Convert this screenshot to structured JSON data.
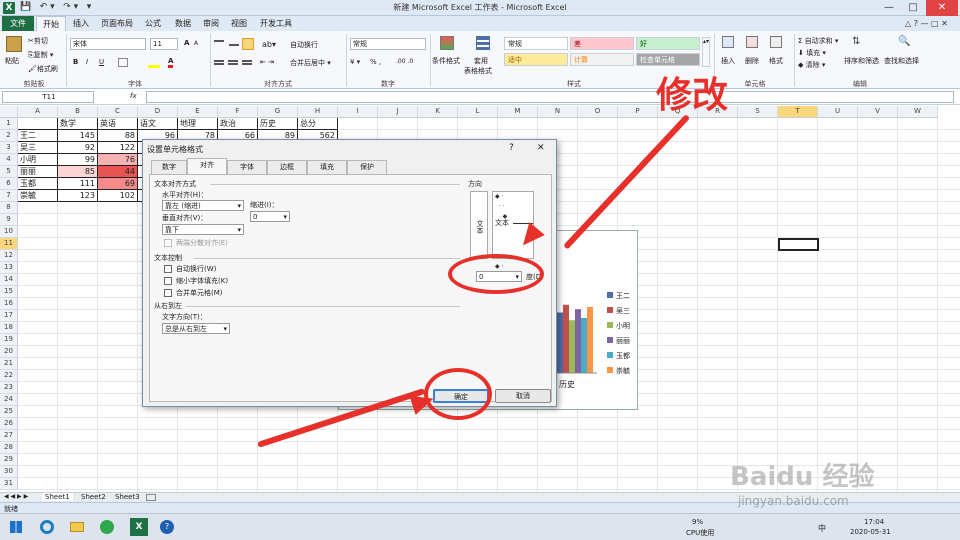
{
  "window": {
    "title": "新建 Microsoft Excel 工作表 - Microsoft Excel",
    "app_icon": "X",
    "qat": [
      "💾",
      "↶ ▾",
      "↷ ▾",
      "▾"
    ],
    "controls": [
      "—",
      "□",
      "✕"
    ],
    "ribbon_controls": [
      "△",
      "?",
      "—",
      "□",
      "✕"
    ]
  },
  "tabs": [
    "文件",
    "开始",
    "插入",
    "页面布局",
    "公式",
    "数据",
    "审阅",
    "视图",
    "开发工具"
  ],
  "ribbon": {
    "clipboard": {
      "paste": "粘贴",
      "cut": "剪切",
      "copy": "复制 ▾",
      "format_painter": "格式刷",
      "label": "剪贴板"
    },
    "font": {
      "name": "宋体",
      "size": "11",
      "bold": "B",
      "italic": "I",
      "underline": "U",
      "grow": "A",
      "shrink": "A",
      "label": "字体"
    },
    "alignment": {
      "wrap": "自动换行",
      "merge": "合并后居中 ▾",
      "label": "对齐方式"
    },
    "number": {
      "format": "常规",
      "percent": "% ,",
      "decimals": ".00 .0",
      "currency": "¥ ▾",
      "label": "数字"
    },
    "styles": {
      "conditional": "条件格式",
      "table": "套用",
      "table2": "表格格式",
      "label": "样式",
      "cells": [
        {
          "text": "常规",
          "bg": "#ffffff",
          "fg": "#222222"
        },
        {
          "text": "差",
          "bg": "#ffc7ce",
          "fg": "#9c0006"
        },
        {
          "text": "好",
          "bg": "#c6efce",
          "fg": "#006100"
        },
        {
          "text": "适中",
          "bg": "#ffeb9c",
          "fg": "#9c6500"
        },
        {
          "text": "计算",
          "bg": "#f2f2f2",
          "fg": "#fa7d00"
        },
        {
          "text": "检查单元格",
          "bg": "#a5a5a5",
          "fg": "#ffffff"
        }
      ]
    },
    "cells": {
      "insert": "插入",
      "delete": "删除",
      "format": "格式",
      "label": "单元格"
    },
    "editing": {
      "autosum": "Σ 自动求和 ▾",
      "fill": "填充 ▾",
      "clear": "清除 ▾",
      "sort": "排序和筛选",
      "find": "查找和选择",
      "label": "编辑"
    }
  },
  "formula_bar": {
    "name_box": "T11",
    "fx": "fx",
    "value": ""
  },
  "columns": [
    "A",
    "B",
    "C",
    "D",
    "E",
    "F",
    "G",
    "H",
    "I",
    "J",
    "K",
    "L",
    "M",
    "N",
    "O",
    "P",
    "Q",
    "R",
    "S",
    "T",
    "U",
    "V",
    "W"
  ],
  "rows": [
    "1",
    "2",
    "3",
    "4",
    "5",
    "6",
    "7",
    "8",
    "9",
    "10",
    "11",
    "12",
    "13",
    "14",
    "15",
    "16",
    "17",
    "18",
    "19",
    "20",
    "21",
    "22",
    "23",
    "24",
    "25",
    "26",
    "27",
    "28",
    "29",
    "30",
    "31"
  ],
  "selected_column": "T",
  "selected_row": "11",
  "sheet": {
    "headers": [
      "",
      "数学",
      "英语",
      "语文",
      "地理",
      "政治",
      "历史",
      "总分"
    ],
    "rows": [
      [
        "王二",
        "145",
        "88",
        "96",
        "78",
        "66",
        "89",
        "562"
      ],
      [
        "吴三",
        "92",
        "122",
        "",
        "",
        "",
        "",
        ""
      ],
      [
        "小明",
        "99",
        "76",
        "",
        "",
        "",
        "",
        ""
      ],
      [
        "丽丽",
        "85",
        "44",
        "",
        "",
        "",
        "",
        ""
      ],
      [
        "玉都",
        "111",
        "69",
        "",
        "",
        "",
        "",
        ""
      ],
      [
        "崇毓",
        "123",
        "102",
        "",
        "",
        "",
        "",
        ""
      ]
    ],
    "highlight": {
      "B5": "#fbd5d5",
      "C4": "#f7b3b3",
      "C5": "#e85454",
      "C6": "#f48a8a"
    }
  },
  "chart": {
    "x_label": "历史",
    "legend": [
      "王二",
      "吴三",
      "小明",
      "丽丽",
      "玉都",
      "崇毓"
    ],
    "colors": [
      "#4f6fa8",
      "#c0504d",
      "#9bbb59",
      "#8064a2",
      "#4bacc6",
      "#f79646"
    ]
  },
  "chart_data": {
    "type": "bar",
    "categories": [
      "历史"
    ],
    "series": [
      {
        "name": "王二",
        "values": [
          89
        ]
      },
      {
        "name": "吴三",
        "values": [
          null
        ]
      },
      {
        "name": "小明",
        "values": [
          null
        ]
      },
      {
        "name": "丽丽",
        "values": [
          null
        ]
      },
      {
        "name": "玉都",
        "values": [
          null
        ]
      },
      {
        "name": "崇毓",
        "values": [
          null
        ]
      }
    ],
    "legend": "right"
  },
  "dialog": {
    "title": "设置单元格格式",
    "help": "?",
    "close": "✕",
    "tabs": [
      "数字",
      "对齐",
      "字体",
      "边框",
      "填充",
      "保护"
    ],
    "active_tab": "对齐",
    "text_alignment": "文本对齐方式",
    "horizontal_label": "水平对齐(H)：",
    "horizontal_value": "靠左 (缩进)",
    "indent_label": "缩进(I)：",
    "indent_value": "0",
    "vertical_label": "垂直对齐(V)：",
    "vertical_value": "靠下",
    "justify_distributed": "两端分散对齐(E)",
    "text_control": "文本控制",
    "wrap_text": "自动换行(W)",
    "shrink_to_fit": "缩小字体填充(K)",
    "merge_cells": "合并单元格(M)",
    "rtl": "从右到左",
    "direction_label": "文字方向(T)：",
    "direction_value": "总是从右到左",
    "orientation": "方向",
    "orientation_text_vertical": "文本",
    "orientation_text": "文本",
    "degrees_value": "0",
    "degrees_label": "度(D)",
    "ok": "确定",
    "cancel": "取消"
  },
  "annotation": {
    "text": "修改",
    "color": "#e8302a"
  },
  "sheet_tabs": [
    "Sheet1",
    "Sheet2",
    "Sheet3"
  ],
  "sheet_nav": "◀ ◀ ▶ ▶",
  "status": {
    "ready": "就绪"
  },
  "taskbar": {
    "cpu": "9%",
    "cpu_label": "CPU使用",
    "time": "17:04",
    "date": "2020-05-31",
    "ime": "中"
  },
  "watermark": {
    "brand": "Baidu 经验",
    "url": "jingyan.baidu.com"
  }
}
